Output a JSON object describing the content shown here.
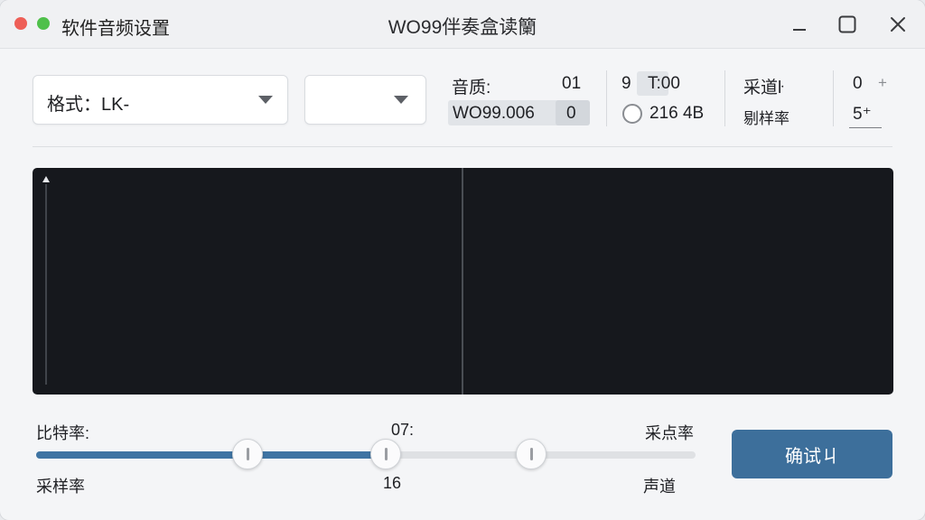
{
  "window": {
    "app_name": "软件音频设置",
    "title": "WO99伴奏盒读籣"
  },
  "format": {
    "label": "格式：LK-",
    "second_select_value": ""
  },
  "quality": {
    "label": "音质:",
    "value_a": "01",
    "field_text": "WO99.006",
    "field_value": "0",
    "num_a": "9",
    "num_b": "T:00",
    "radio_text": "216 4B",
    "channel_label": "采道ŀ",
    "channel_value": "0",
    "channel_plus": "+",
    "sample_label": "剔样率",
    "sample_value": "5⁺"
  },
  "waveform": {
    "colors": {
      "low": "#5f86c9",
      "mid": "#5ab0a0",
      "high": "#6aa9c2"
    }
  },
  "slider": {
    "top_left_label": "比特率:",
    "top_mid_label": "07:",
    "top_right_label": "采点率",
    "bottom_left_label": "采样率",
    "bottom_mid_label": "16",
    "bottom_right_label": "声道",
    "fill_fraction": 0.53,
    "knob_fractions": [
      0.32,
      0.53,
      0.75
    ]
  },
  "actions": {
    "confirm_label": "确试ㄐ"
  },
  "colors": {
    "accent": "#3d6f9b",
    "slider_fill": "#3f74a3",
    "close_dot": "#ee5f57",
    "max_dot": "#4fc04a"
  }
}
